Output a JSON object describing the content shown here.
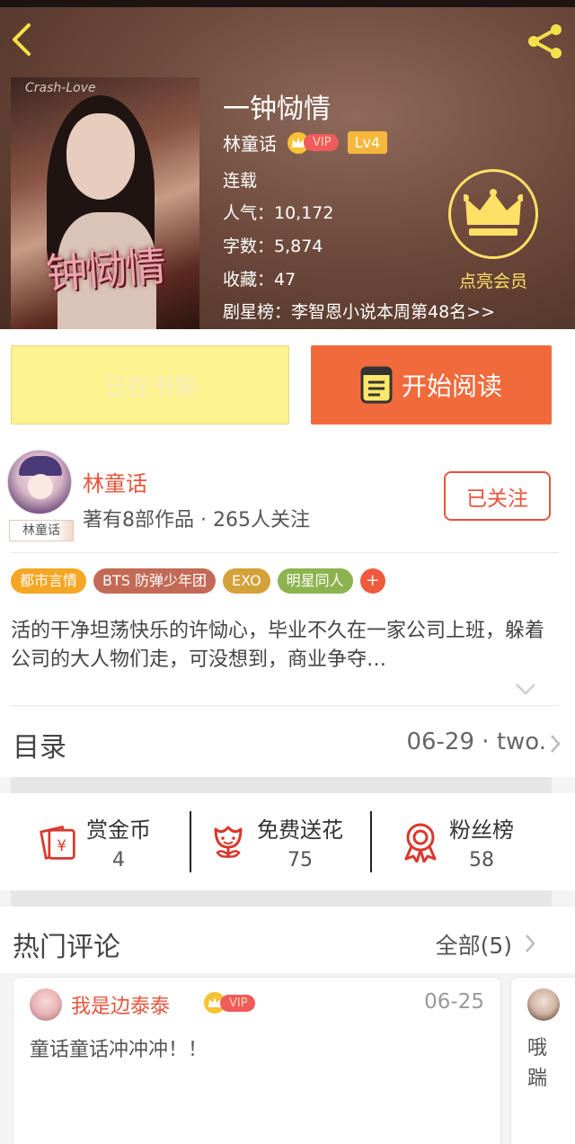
{
  "book": {
    "title": "一钟恸情",
    "author": "林童话",
    "vip": "VIP",
    "level": "Lv4",
    "status": "连载",
    "popularity": "人气：10,172",
    "wordcount": "字数：5,874",
    "favorites": "收藏：47",
    "ranking": "剧星榜：李智恩小说本周第48名>>",
    "cover_art_text": "钟恸情",
    "cover_small_text": "Crash-Love"
  },
  "member": {
    "label": "点亮会员"
  },
  "actions": {
    "shelf": "已在书架",
    "read": "开始阅读"
  },
  "author_card": {
    "name": "林童话",
    "avatar_tag": "林童话",
    "stats": "著有8部作品 · 265人关注",
    "follow": "已关注"
  },
  "tags": [
    {
      "label": "都市言情",
      "color": "#f5a623"
    },
    {
      "label": "BTS 防弹少年团",
      "color": "#c36a57"
    },
    {
      "label": "EXO",
      "color": "#d5a13a"
    },
    {
      "label": "明星同人",
      "color": "#8cb34f"
    },
    {
      "label": "+",
      "color": "#ef5a3c"
    }
  ],
  "description": "活的干净坦荡快乐的许恸心，毕业不久在一家公司上班，躲着公司的大人物们走，可没想到，商业争夺…",
  "catalog": {
    "title": "目录",
    "latest": "06-29 · two."
  },
  "stats": [
    {
      "label": "赏金币",
      "value": "4"
    },
    {
      "label": "免费送花",
      "value": "75"
    },
    {
      "label": "粉丝榜",
      "value": "58"
    }
  ],
  "comments": {
    "title": "热门评论",
    "all": "全部(5)",
    "items": [
      {
        "user": "我是边泰泰",
        "vip": "VIP",
        "date": "06-25",
        "text": "童话童话冲冲冲！！"
      },
      {
        "text": "哦踹"
      }
    ]
  },
  "colors": {
    "accent": "#e7553b",
    "read_button": "#f16a3c",
    "shelf_button": "#fef391",
    "member_gold": "#ffe066"
  }
}
